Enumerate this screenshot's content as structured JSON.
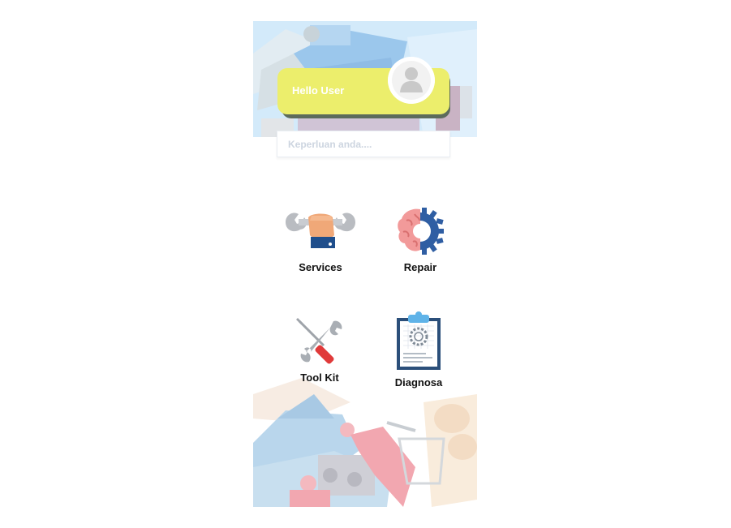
{
  "greeting": {
    "text": "Hello User"
  },
  "search": {
    "placeholder": "Keperluan anda...."
  },
  "menu": {
    "items": [
      {
        "label": "Services",
        "icon": "hand-wrench-icon"
      },
      {
        "label": "Repair",
        "icon": "brain-gear-icon"
      },
      {
        "label": "Tool Kit",
        "icon": "tool-kit-icon"
      },
      {
        "label": "Diagnosa",
        "icon": "clipboard-icon"
      }
    ]
  },
  "colors": {
    "greeting_card": "#ecee6c",
    "header_bg": "#bfe0f6",
    "label_text": "#111111"
  }
}
